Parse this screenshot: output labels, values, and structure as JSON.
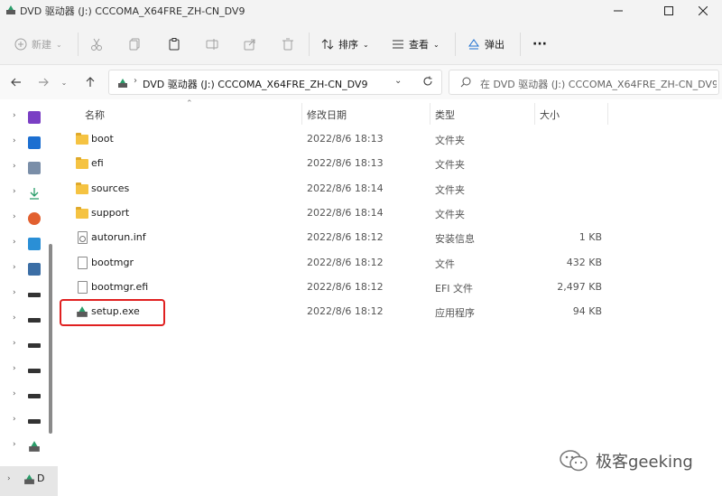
{
  "window": {
    "title": "DVD 驱动器 (J:) CCCOMA_X64FRE_ZH-CN_DV9",
    "controls": [
      "minimize",
      "maximize",
      "close"
    ]
  },
  "toolbar": {
    "new_label": "新建",
    "sort_label": "排序",
    "view_label": "查看",
    "eject_label": "弹出",
    "more_label": "···"
  },
  "navigation": {
    "address_path": "DVD 驱动器 (J:) CCCOMA_X64FRE_ZH-CN_DV9",
    "search_placeholder": "在 DVD 驱动器 (J:) CCCOMA_X64FRE_ZH-CN_DV9"
  },
  "sidebar": {
    "items": [
      {
        "icon": "video-icon",
        "color": "#7a3fc4"
      },
      {
        "icon": "pictures-icon",
        "color": "#1c6fd1"
      },
      {
        "icon": "documents-icon",
        "color": "#7a8ea8"
      },
      {
        "icon": "downloads-icon",
        "color": "#2a9d6a"
      },
      {
        "icon": "music-icon",
        "color": "#e2602f"
      },
      {
        "icon": "desktop-icon",
        "color": "#2a8fd6"
      },
      {
        "icon": "this-pc-icon",
        "color": "#3b6ea5"
      },
      {
        "icon": "drive-icon",
        "color": "#333333"
      },
      {
        "icon": "drive-icon",
        "color": "#333333"
      },
      {
        "icon": "drive-icon",
        "color": "#333333"
      },
      {
        "icon": "drive-icon",
        "color": "#333333"
      },
      {
        "icon": "drive-icon",
        "color": "#333333"
      },
      {
        "icon": "drive-icon",
        "color": "#333333"
      },
      {
        "icon": "dvd-drive-icon",
        "color": "#2a9d6a"
      }
    ],
    "selected_label": "D"
  },
  "columns": {
    "name": "名称",
    "date": "修改日期",
    "type": "类型",
    "size": "大小"
  },
  "files": [
    {
      "name": "boot",
      "date": "2022/8/6 18:13",
      "type": "文件夹",
      "size": "",
      "icon": "folder-icon"
    },
    {
      "name": "efi",
      "date": "2022/8/6 18:13",
      "type": "文件夹",
      "size": "",
      "icon": "folder-icon"
    },
    {
      "name": "sources",
      "date": "2022/8/6 18:14",
      "type": "文件夹",
      "size": "",
      "icon": "folder-icon"
    },
    {
      "name": "support",
      "date": "2022/8/6 18:14",
      "type": "文件夹",
      "size": "",
      "icon": "folder-icon"
    },
    {
      "name": "autorun.inf",
      "date": "2022/8/6 18:12",
      "type": "安装信息",
      "size": "1 KB",
      "icon": "settings-file-icon"
    },
    {
      "name": "bootmgr",
      "date": "2022/8/6 18:12",
      "type": "文件",
      "size": "432 KB",
      "icon": "file-icon"
    },
    {
      "name": "bootmgr.efi",
      "date": "2022/8/6 18:12",
      "type": "EFI 文件",
      "size": "2,497 KB",
      "icon": "file-icon"
    },
    {
      "name": "setup.exe",
      "date": "2022/8/6 18:12",
      "type": "应用程序",
      "size": "94 KB",
      "icon": "setup-app-icon"
    }
  ],
  "highlight": {
    "target": "setup.exe",
    "color": "#e02020"
  },
  "watermark": {
    "text": "极客geeking"
  }
}
